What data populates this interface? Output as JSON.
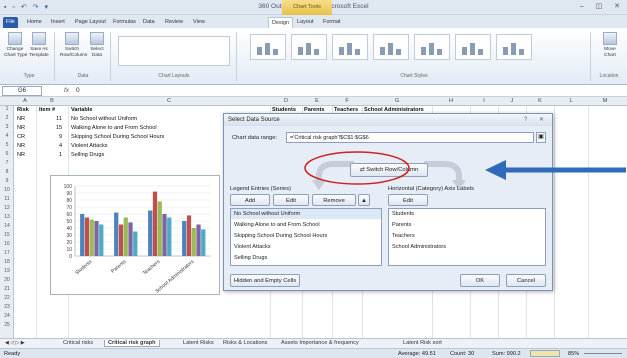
{
  "window": {
    "qat": "▪ ▫ ↶ ↷ ▾",
    "title": "360 Output for report - Microsoft Excel",
    "context_tab": "Chart Tools",
    "controls": "– ◫ ✕"
  },
  "tabs": [
    "File",
    "Home",
    "Insert",
    "Page Layout",
    "Formulas",
    "Data",
    "Review",
    "View",
    "Design",
    "Layout",
    "Format"
  ],
  "ribbon": {
    "buttons": [
      {
        "label": "Change\nChart Type"
      },
      {
        "label": "Save As\nTemplate"
      },
      {
        "label": "Switch\nRow/Column"
      },
      {
        "label": "Select\nData"
      },
      {
        "label": "Move\nChart"
      }
    ],
    "groups": [
      "Type",
      "Data",
      "Chart Layouts",
      "Chart Styles",
      "Location"
    ]
  },
  "formula_bar": {
    "name_box": "G6",
    "fx": "fx",
    "value": "0"
  },
  "columns": [
    "A",
    "B",
    "C",
    "D",
    "E",
    "F",
    "G",
    "H",
    "I",
    "J",
    "K",
    "L",
    "M"
  ],
  "rows": [
    "1",
    "2",
    "3",
    "4",
    "5",
    "6",
    "7",
    "8",
    "9",
    "10",
    "11",
    "12",
    "13",
    "14",
    "15",
    "16",
    "17",
    "18",
    "19",
    "20",
    "21",
    "22",
    "23",
    "24",
    "25"
  ],
  "cells": {
    "a1": "Risk",
    "b1": "Item #",
    "c1": "Variable",
    "d1": "Students",
    "e1": "Parents",
    "f1": "Teachers",
    "g1": "School Administrators",
    "rows": [
      {
        "risk": "NR",
        "item": "11",
        "var": "No School without Uniform"
      },
      {
        "risk": "NR",
        "item": "15",
        "var": "Walking Alone to and From School"
      },
      {
        "risk": "CR",
        "item": "9",
        "var": "Skipping School During School Hours"
      },
      {
        "risk": "NR",
        "item": "4",
        "var": "Violent Attacks"
      },
      {
        "risk": "NR",
        "item": "1",
        "var": "Selling Drugs"
      }
    ]
  },
  "chart_data": {
    "type": "bar",
    "categories": [
      "Students",
      "Parents",
      "Teachers",
      "School Administrators"
    ],
    "ylim": [
      0,
      100
    ],
    "yticks": [
      "100",
      "90",
      "80",
      "70",
      "60",
      "50",
      "40",
      "30",
      "20",
      "10",
      "0"
    ],
    "series": [
      {
        "color": "#4f81bd",
        "values": [
          60,
          62,
          65,
          50
        ]
      },
      {
        "color": "#c0504d",
        "values": [
          55,
          45,
          92,
          58
        ]
      },
      {
        "color": "#9bbb59",
        "values": [
          52,
          55,
          78,
          40
        ]
      },
      {
        "color": "#8064a2",
        "values": [
          50,
          48,
          60,
          45
        ]
      },
      {
        "color": "#4bacc6",
        "values": [
          45,
          35,
          55,
          38
        ]
      }
    ]
  },
  "dialog": {
    "title": "Select Data Source",
    "title_controls": "? ✕",
    "range_label": "Chart data range:",
    "range_value": "='Critical risk graph'!$C$1:$G$6",
    "switch_label": "Switch Row/Column",
    "legend_header": "Legend Entries (Series)",
    "add": "Add",
    "edit": "Edit",
    "remove": "Remove",
    "axis_header": "Horizontal (Category) Axis Labels",
    "axis_edit": "Edit",
    "series_items": [
      "No School without Uniform",
      "Walking Alone to and From School",
      "Skipping School During School Hours",
      "Violent Attacks",
      "Selling Drugs"
    ],
    "axis_items": [
      "Students",
      "Parents",
      "Teachers",
      "School Administrators"
    ],
    "hidden_cells": "Hidden and Empty Cells",
    "ok": "OK",
    "cancel": "Cancel"
  },
  "sheet_tabs": [
    "Critical risks",
    "Critical risk graph",
    "Latent Risks",
    "Risks & Locations",
    "Assets Importance & frequency",
    "Latent Risk sort"
  ],
  "status": {
    "ready": "Ready",
    "average": "Average: 49.51",
    "count": "Count: 30",
    "sum": "Sum: 990.2",
    "zoom": "85%"
  },
  "colors": {
    "accent": "#2a5caa",
    "annotation_arrow": "#2e6bb8",
    "annotation_circle": "#cc2222"
  }
}
